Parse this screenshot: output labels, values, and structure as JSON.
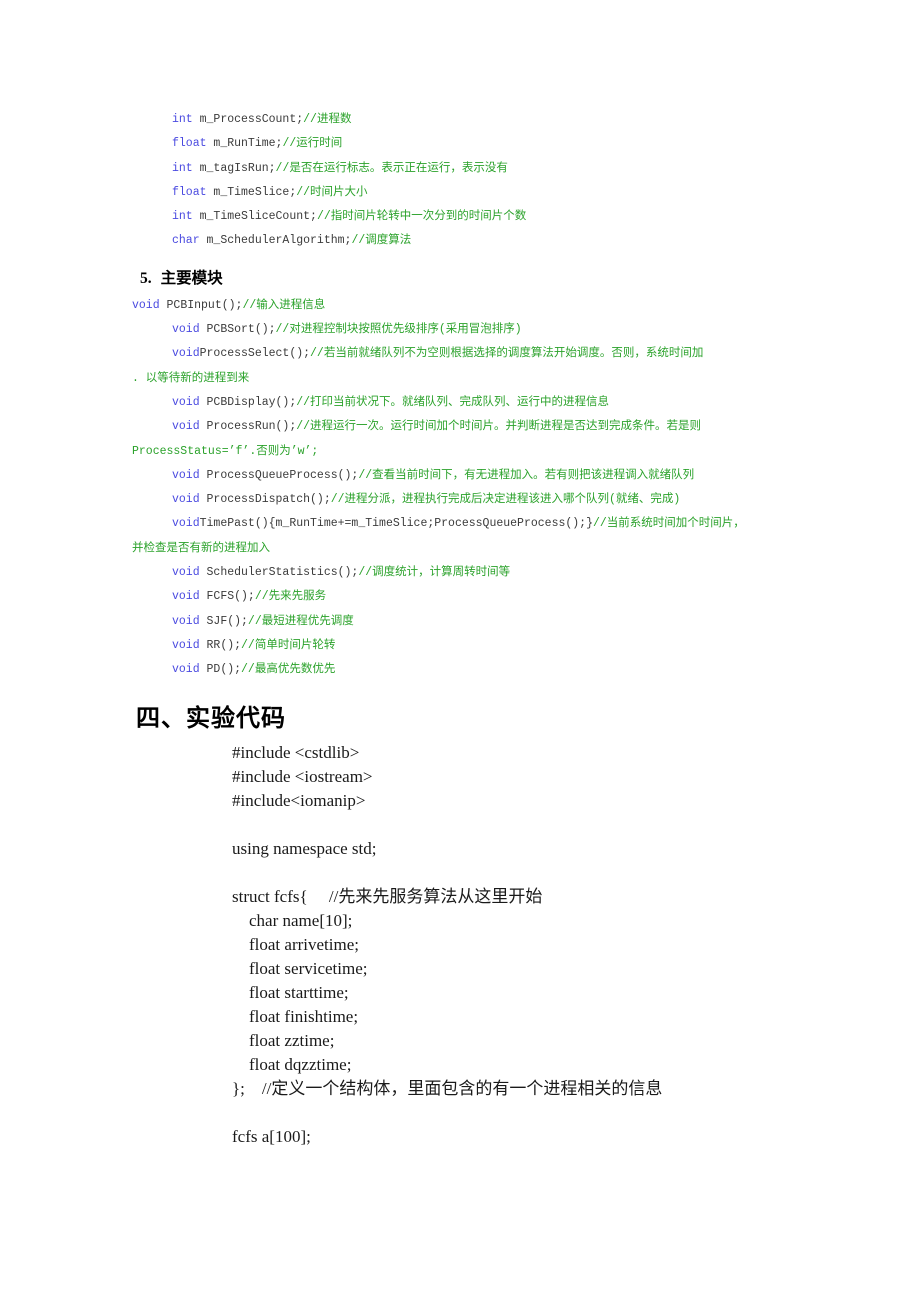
{
  "document": {
    "colors": {
      "keyword": "#4a4ae0",
      "comment": "#2ba22b",
      "identifier": "#3b3b3b",
      "text": "#000000",
      "background": "#ffffff"
    }
  },
  "struct_members": {
    "lines": [
      {
        "kw": "int",
        "id": " m_ProcessCount;",
        "cmt": "//进程数"
      },
      {
        "kw": "float",
        "id": " m_RunTime;",
        "cmt": "//运行时间"
      },
      {
        "kw": "int",
        "id": " m_tagIsRun;",
        "cmt": "//是否在运行标志。表示正在运行，表示没有"
      },
      {
        "kw": "float",
        "id": " m_TimeSlice;",
        "cmt": "//时间片大小"
      },
      {
        "kw": "int",
        "id": " m_TimeSliceCount;",
        "cmt": "//指时间片轮转中一次分到的时间片个数"
      },
      {
        "kw": "char",
        "id": " m_SchedulerAlgorithm;",
        "cmt": "//调度算法"
      }
    ]
  },
  "section_modules": {
    "heading_number": "5.",
    "heading_title": "主要模块",
    "lines": [
      {
        "indent": 0,
        "kw": "void",
        "id": " PCBInput();",
        "cmt": "//输入进程信息"
      },
      {
        "indent": 1,
        "kw": "void",
        "id": " PCBSort();",
        "cmt": "//对进程控制块按照优先级排序(采用冒泡排序)"
      },
      {
        "indent": 1,
        "kw": "void",
        "id": "ProcessSelect();",
        "cmt": "//若当前就绪队列不为空则根据选择的调度算法开始调度。否则，系统时间加"
      },
      {
        "indent": 0,
        "kw": "",
        "id": "",
        "cmt": ". 以等待新的进程到来"
      },
      {
        "indent": 1,
        "kw": "void",
        "id": " PCBDisplay();",
        "cmt": "//打印当前状况下。就绪队列、完成队列、运行中的进程信息"
      },
      {
        "indent": 1,
        "kw": "void",
        "id": " ProcessRun();",
        "cmt": "//进程运行一次。运行时间加个时间片。并判断进程是否达到完成条件。若是则"
      },
      {
        "indent": 0,
        "kw": "",
        "id": "",
        "cmt": "ProcessStatus=’f’.否则为’w’;"
      },
      {
        "indent": 1,
        "kw": "void",
        "id": " ProcessQueueProcess();",
        "cmt": "//查看当前时间下，有无进程加入。若有则把该进程调入就绪队列"
      },
      {
        "indent": 1,
        "kw": "void",
        "id": " ProcessDispatch();",
        "cmt": "//进程分派，进程执行完成后决定进程该进入哪个队列(就绪、完成)"
      },
      {
        "indent": 1,
        "kw": "void",
        "id": "TimePast(){m_RunTime+=m_TimeSlice;ProcessQueueProcess();}",
        "cmt": "//当前系统时间加个时间片，"
      },
      {
        "indent": 0,
        "kw": "",
        "id": "",
        "cmt": "并检查是否有新的进程加入"
      },
      {
        "indent": 1,
        "kw": "void",
        "id": " SchedulerStatistics();",
        "cmt": "//调度统计，计算周转时间等"
      },
      {
        "indent": 1,
        "kw": "void",
        "id": " FCFS();",
        "cmt": "//先来先服务"
      },
      {
        "indent": 1,
        "kw": "void",
        "id": " SJF();",
        "cmt": "//最短进程优先调度"
      },
      {
        "indent": 1,
        "kw": "void",
        "id": " RR();",
        "cmt": "//简单时间片轮转"
      },
      {
        "indent": 1,
        "kw": "void",
        "id": " PD();",
        "cmt": "//最高优先数优先"
      }
    ]
  },
  "section_code": {
    "heading": "四、实验代码",
    "lines": [
      "#include <cstdlib>",
      "#include <iostream>",
      "#include<iomanip>",
      "",
      "using namespace std;",
      "",
      "struct fcfs{     //先来先服务算法从这里开始",
      "    char name[10];",
      "    float arrivetime;",
      "    float servicetime;",
      "    float starttime;",
      "    float finishtime;",
      "    float zztime;",
      "    float dqzztime;",
      "};    //定义一个结构体，里面包含的有一个进程相关的信息",
      "",
      "fcfs a[100];"
    ]
  }
}
